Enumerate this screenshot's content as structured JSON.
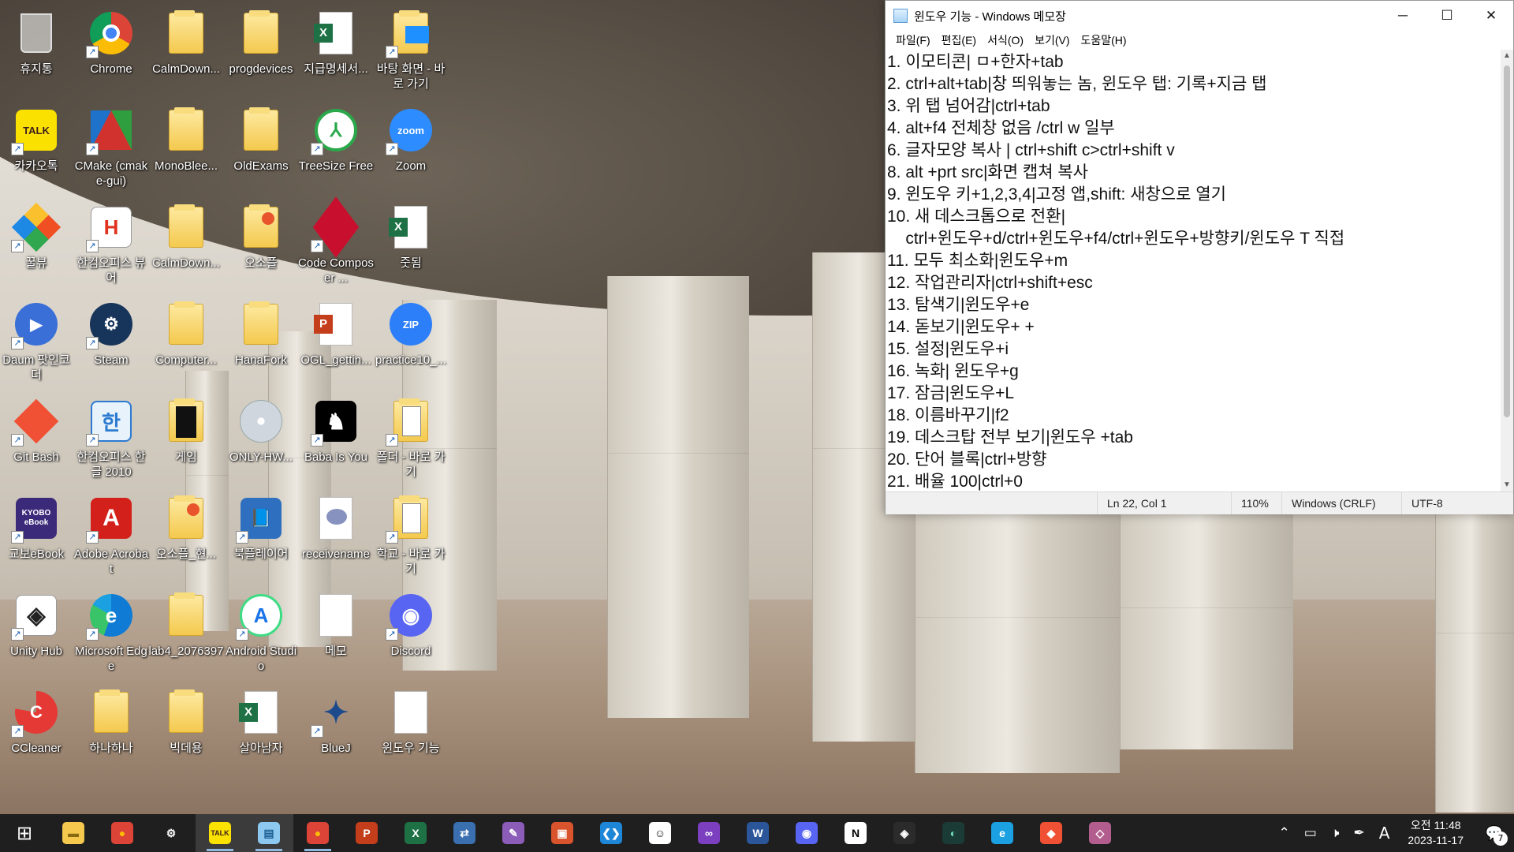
{
  "desktop_icons": [
    {
      "label": "휴지통",
      "icon": "recycle-bin-icon",
      "kind": "recycle",
      "col": 0,
      "row": 0,
      "shortcut": false
    },
    {
      "label": "Chrome",
      "icon": "chrome-icon",
      "kind": "chrome",
      "col": 1,
      "row": 0,
      "shortcut": true
    },
    {
      "label": "CalmDown...",
      "icon": "folder-icon",
      "kind": "folder",
      "col": 2,
      "row": 0,
      "shortcut": false
    },
    {
      "label": "progdevices",
      "icon": "folder-icon",
      "kind": "folder",
      "col": 3,
      "row": 0,
      "shortcut": false
    },
    {
      "label": "지급명세서...",
      "icon": "excel-file-icon",
      "kind": "excel",
      "col": 4,
      "row": 0,
      "shortcut": false
    },
    {
      "label": "바탕 화면 - 바로 가기",
      "icon": "desktop-shortcut-icon",
      "kind": "folderblue",
      "col": 5,
      "row": 0,
      "shortcut": true
    },
    {
      "label": "카카오톡",
      "icon": "kakaotalk-icon",
      "kind": "kakao",
      "col": 0,
      "row": 1,
      "shortcut": true
    },
    {
      "label": "CMake (cmake-gui)",
      "icon": "cmake-icon",
      "kind": "cmake",
      "col": 1,
      "row": 1,
      "shortcut": true
    },
    {
      "label": "MonoBlee...",
      "icon": "folder-icon",
      "kind": "folder",
      "col": 2,
      "row": 1,
      "shortcut": false
    },
    {
      "label": "OldExams",
      "icon": "folder-icon",
      "kind": "folder",
      "col": 3,
      "row": 1,
      "shortcut": false
    },
    {
      "label": "TreeSize Free",
      "icon": "treesize-icon",
      "kind": "treesize",
      "col": 4,
      "row": 1,
      "shortcut": true
    },
    {
      "label": "Zoom",
      "icon": "zoom-icon",
      "kind": "zoom",
      "col": 5,
      "row": 1,
      "shortcut": true
    },
    {
      "label": "꿀뷰",
      "icon": "honeyview-icon",
      "kind": "honeyview",
      "col": 0,
      "row": 2,
      "shortcut": true
    },
    {
      "label": "한컴오피스 뷰어",
      "icon": "hancom-viewer-icon",
      "kind": "hviewer",
      "col": 1,
      "row": 2,
      "shortcut": true
    },
    {
      "label": "CalmDown...",
      "icon": "folder-icon",
      "kind": "folder",
      "col": 2,
      "row": 2,
      "shortcut": false
    },
    {
      "label": "오소플",
      "icon": "folder-icon",
      "kind": "folderred",
      "col": 3,
      "row": 2,
      "shortcut": false
    },
    {
      "label": "Code Composer ...",
      "icon": "code-composer-icon",
      "kind": "ccs",
      "col": 4,
      "row": 2,
      "shortcut": true
    },
    {
      "label": "줏됨",
      "icon": "excel-file-icon",
      "kind": "excel",
      "col": 5,
      "row": 2,
      "shortcut": false
    },
    {
      "label": "Daum 팟인코더",
      "icon": "daum-potencoder-icon",
      "kind": "potencoder",
      "col": 0,
      "row": 3,
      "shortcut": true
    },
    {
      "label": "Steam",
      "icon": "steam-icon",
      "kind": "steam",
      "col": 1,
      "row": 3,
      "shortcut": true
    },
    {
      "label": "Computer...",
      "icon": "folder-icon",
      "kind": "folder",
      "col": 2,
      "row": 3,
      "shortcut": false
    },
    {
      "label": "HanaFork",
      "icon": "folder-icon",
      "kind": "folder",
      "col": 3,
      "row": 3,
      "shortcut": false
    },
    {
      "label": "OGL_gettin...",
      "icon": "powerpoint-file-icon",
      "kind": "ppt",
      "col": 4,
      "row": 3,
      "shortcut": false
    },
    {
      "label": "practice10_...",
      "icon": "zip-file-icon",
      "kind": "zip",
      "col": 5,
      "row": 3,
      "shortcut": false
    },
    {
      "label": "Git Bash",
      "icon": "git-bash-icon",
      "kind": "git",
      "col": 0,
      "row": 4,
      "shortcut": true
    },
    {
      "label": "한컴오피스 한글 2010",
      "icon": "hangul-icon",
      "kind": "hangul",
      "col": 1,
      "row": 4,
      "shortcut": true
    },
    {
      "label": "게임",
      "icon": "folder-icon",
      "kind": "folderdark",
      "col": 2,
      "row": 4,
      "shortcut": false
    },
    {
      "label": "ONLY-HW...",
      "icon": "disc-image-icon",
      "kind": "disc",
      "col": 3,
      "row": 4,
      "shortcut": false
    },
    {
      "label": "Baba Is You",
      "icon": "baba-is-you-icon",
      "kind": "baba",
      "col": 4,
      "row": 4,
      "shortcut": true
    },
    {
      "label": "폴더 - 바로 가기",
      "icon": "folder-shortcut-icon",
      "kind": "folderdoc",
      "col": 5,
      "row": 4,
      "shortcut": true
    },
    {
      "label": "교보eBook",
      "icon": "kyobo-ebook-icon",
      "kind": "kyobo",
      "col": 0,
      "row": 5,
      "shortcut": true
    },
    {
      "label": "Adobe Acrobat",
      "icon": "acrobat-icon",
      "kind": "acrobat",
      "col": 1,
      "row": 5,
      "shortcut": true
    },
    {
      "label": "오소플_현...",
      "icon": "folder-icon",
      "kind": "folderred",
      "col": 2,
      "row": 5,
      "shortcut": false
    },
    {
      "label": "북플레이어",
      "icon": "bookplayer-icon",
      "kind": "bookplayer",
      "col": 3,
      "row": 5,
      "shortcut": true
    },
    {
      "label": "receivename",
      "icon": "php-file-icon",
      "kind": "php",
      "col": 4,
      "row": 5,
      "shortcut": false
    },
    {
      "label": "학교 - 바로 가기",
      "icon": "folder-shortcut-icon",
      "kind": "folderdoc",
      "col": 5,
      "row": 5,
      "shortcut": true
    },
    {
      "label": "Unity Hub",
      "icon": "unity-hub-icon",
      "kind": "unity",
      "col": 0,
      "row": 6,
      "shortcut": true
    },
    {
      "label": "Microsoft Edge",
      "icon": "edge-icon",
      "kind": "edge",
      "col": 1,
      "row": 6,
      "shortcut": true
    },
    {
      "label": "lab4_2076397",
      "icon": "folder-icon",
      "kind": "folder",
      "col": 2,
      "row": 6,
      "shortcut": false
    },
    {
      "label": "Android Studio",
      "icon": "android-studio-icon",
      "kind": "android",
      "col": 3,
      "row": 6,
      "shortcut": true
    },
    {
      "label": "메모",
      "icon": "text-file-icon",
      "kind": "doc",
      "col": 4,
      "row": 6,
      "shortcut": false
    },
    {
      "label": "Discord",
      "icon": "discord-icon",
      "kind": "discord",
      "col": 5,
      "row": 6,
      "shortcut": true
    },
    {
      "label": "CCleaner",
      "icon": "ccleaner-icon",
      "kind": "ccleaner",
      "col": 0,
      "row": 7,
      "shortcut": true
    },
    {
      "label": "하나하나",
      "icon": "folder-icon",
      "kind": "folder",
      "col": 1,
      "row": 7,
      "shortcut": false
    },
    {
      "label": "빅데용",
      "icon": "folder-icon",
      "kind": "folder",
      "col": 2,
      "row": 7,
      "shortcut": false
    },
    {
      "label": "살아남자",
      "icon": "excel-file-icon",
      "kind": "excel",
      "col": 3,
      "row": 7,
      "shortcut": false
    },
    {
      "label": "BlueJ",
      "icon": "bluej-icon",
      "kind": "bluej",
      "col": 4,
      "row": 7,
      "shortcut": true
    },
    {
      "label": "윈도우 기능",
      "icon": "text-file-icon",
      "kind": "doc",
      "col": 5,
      "row": 7,
      "shortcut": false
    }
  ],
  "notepad": {
    "title": "윈도우 기능 - Windows 메모장",
    "menu": [
      "파일(F)",
      "편집(E)",
      "서식(O)",
      "보기(V)",
      "도움말(H)"
    ],
    "lines": [
      "1. 이모티콘| ㅁ+한자+tab",
      "2. ctrl+alt+tab|창 띄워놓는 놈, 윈도우 탭: 기록+지금 탭",
      "3. 위 탭 넘어감|ctrl+tab",
      "4. alt+f4 전체창 없음 /ctrl w 일부",
      "6. 글자모양 복사 | ctrl+shift c>ctrl+shift v",
      "8. alt +prt src|화면 캡쳐 복사",
      "9. 윈도우 키+1,2,3,4|고정 앱,shift: 새창으로 열기",
      "10. 새 데스크톱으로 전환|",
      "    ctrl+윈도우+d/ctrl+윈도우+f4/ctrl+윈도우+방향키/윈도우 T 직접",
      "11. 모두 최소화|윈도우+m",
      "12. 작업관리자|ctrl+shift+esc",
      "13. 탐색기|윈도우+e",
      "14. 돋보기|윈도우+ +",
      "15. 설정|윈도우+i",
      "16. 녹화| 윈도우+g",
      "17. 잠금|윈도우+L",
      "18. 이름바꾸기|f2",
      "19. 데스크탑 전부 보기|윈도우 +tab",
      "20. 단어 블록|ctrl+방향",
      "21. 배율 100|ctrl+0"
    ],
    "status": {
      "position": "Ln 22, Col 1",
      "zoom": "110%",
      "line_ending": "Windows (CRLF)",
      "encoding": "UTF-8"
    },
    "controls": {
      "minimize": "─",
      "maximize": "☐",
      "close": "✕"
    }
  },
  "taskbar": {
    "items": [
      {
        "name": "start-button",
        "glyph": "⊞",
        "color": "#1f1f1f",
        "fg": "#ffffff"
      },
      {
        "name": "file-explorer",
        "glyph": "▬",
        "color": "#f4c94e",
        "fg": "#8a6a10"
      },
      {
        "name": "chrome",
        "glyph": "●",
        "color": "#db4437",
        "fg": "#fbbc05"
      },
      {
        "name": "settings",
        "glyph": "⚙",
        "color": "#1f1f1f",
        "fg": "#ffffff"
      },
      {
        "name": "kakaotalk",
        "glyph": "TALK",
        "color": "#fae100",
        "fg": "#3c1e1e",
        "active": true
      },
      {
        "name": "notepad",
        "glyph": "▤",
        "color": "#8cc8f0",
        "fg": "#1d5f93",
        "active": true
      },
      {
        "name": "chrome-2",
        "glyph": "●",
        "color": "#db4437",
        "fg": "#fbbc05",
        "running": true
      },
      {
        "name": "powerpoint",
        "glyph": "P",
        "color": "#c43e1c",
        "fg": "#ffffff"
      },
      {
        "name": "excel",
        "glyph": "X",
        "color": "#1e7145",
        "fg": "#ffffff"
      },
      {
        "name": "network-tool",
        "glyph": "⇄",
        "color": "#3a6fb0",
        "fg": "#ffffff"
      },
      {
        "name": "paint",
        "glyph": "✎",
        "color": "#8b5cb8",
        "fg": "#ffffff"
      },
      {
        "name": "photos",
        "glyph": "▣",
        "color": "#d9532c",
        "fg": "#ffffff"
      },
      {
        "name": "vscode",
        "glyph": "❮❯",
        "color": "#1e86d6",
        "fg": "#ffffff"
      },
      {
        "name": "chat-app",
        "glyph": "☺",
        "color": "#ffffff",
        "fg": "#222222"
      },
      {
        "name": "visual-studio",
        "glyph": "∞",
        "color": "#7b3fbf",
        "fg": "#ffffff"
      },
      {
        "name": "word",
        "glyph": "W",
        "color": "#2b579a",
        "fg": "#ffffff"
      },
      {
        "name": "discord",
        "glyph": "◉",
        "color": "#5865f2",
        "fg": "#ffffff"
      },
      {
        "name": "notion",
        "glyph": "N",
        "color": "#ffffff",
        "fg": "#000000"
      },
      {
        "name": "unity",
        "glyph": "◈",
        "color": "#2b2b2b",
        "fg": "#ffffff"
      },
      {
        "name": "app-green",
        "glyph": "◐",
        "color": "#1b3b36",
        "fg": "#6fe0c0"
      },
      {
        "name": "edge",
        "glyph": "e",
        "color": "#1ba1e2",
        "fg": "#ffffff"
      },
      {
        "name": "git",
        "glyph": "◆",
        "color": "#f05033",
        "fg": "#ffffff"
      },
      {
        "name": "app-stack",
        "glyph": "◇",
        "color": "#b25d8e",
        "fg": "#ffffff"
      }
    ],
    "tray": {
      "chevron": "⌃",
      "battery": "▭",
      "volume": "🕨",
      "pen": "✒",
      "ime": "A"
    },
    "clock": {
      "time": "오전 11:48",
      "date": "2023-11-17"
    },
    "notifications": {
      "count": "7",
      "glyph": "💬"
    }
  }
}
